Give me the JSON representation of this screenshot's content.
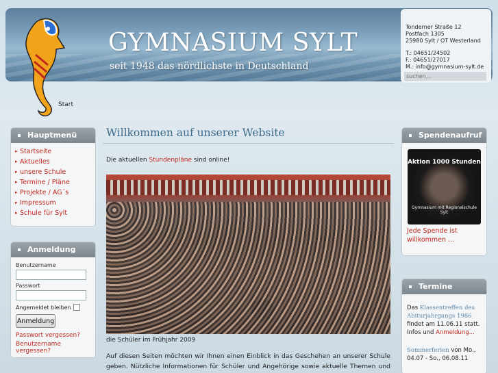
{
  "header": {
    "title": "GYMNASIUM SYLT",
    "subtitle": "seit 1948 das nördlichste in Deutschland"
  },
  "address": {
    "street": "Tonderner Straße 12",
    "postbox": "Postfach 1305",
    "city": "25980 Sylt / OT Westerland",
    "phone": "T.: 04651/24502",
    "fax": "F.: 04651/27017",
    "mail": "M.: info@gymnasium-sylt.de"
  },
  "search": {
    "placeholder": "suchen..."
  },
  "breadcrumb": "Start",
  "mainmenu": {
    "title": "Hauptmenü",
    "items": [
      "Startseite",
      "Aktuelles",
      "unsere Schule",
      "Termine / Pläne",
      "Projekte / AG´s",
      "Impressum",
      "Schule für Sylt"
    ]
  },
  "login": {
    "title": "Anmeldung",
    "username_label": "Benutzername",
    "password_label": "Passwort",
    "remember_label": "Angemeldet bleiben",
    "button": "Anmeldung",
    "forgot_password": "Passwort vergessen?",
    "forgot_username": "Benutzername vergessen?"
  },
  "main": {
    "heading": "Willkommen auf unserer Website",
    "intro_before": "Die aktuellen ",
    "intro_link": "Stundenpläne",
    "intro_after": " sind online!",
    "caption": "die Schüler im Frühjahr 2009",
    "body": "Auf diesen Seiten möchten wir Ihnen einen Einblick in das Geschehen an unserer Schule geben. Nützliche Informationen für Schüler und Angehörige sowie aktuelle Themen und Informationen stehen hier für Sie bereit."
  },
  "donation": {
    "title": "Spendenaufruf",
    "badge_top": "Aktion 1000 Stunden",
    "badge_bottom": "Gymnasium mit Regionalschule Sylt",
    "link": "Jede Spende ist willkommen ..."
  },
  "dates": {
    "title": "Termine",
    "item1_prefix": "Das ",
    "item1_event": "Klassentreffen des Abiturjahrgangs 1986",
    "item1_text": " findet am 11.06.11 statt. Infos und ",
    "item1_link": "Anmeldung...",
    "item2_event": "Sommerferien",
    "item2_text": " von Mo., 04.07 - So., 06.08.11"
  },
  "colors": {
    "accent": "#c0281d",
    "heading": "#3d6b8a"
  }
}
